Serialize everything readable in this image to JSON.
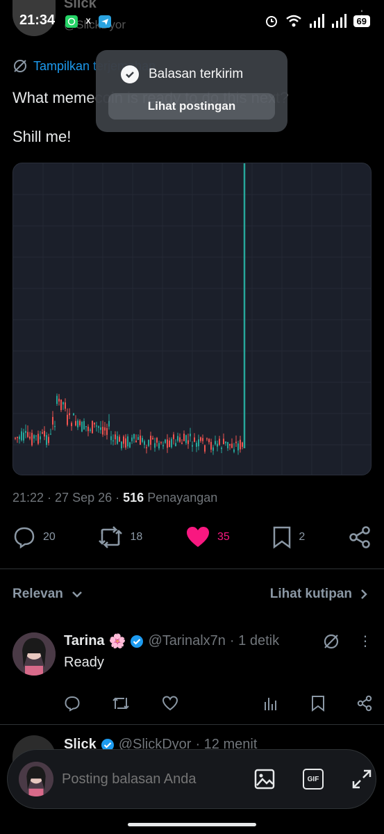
{
  "status_bar": {
    "time": "21:34",
    "apps": [
      {
        "icon": "whatsapp-icon",
        "color": "#25d366"
      },
      {
        "icon": "x-icon",
        "color": "#000000"
      },
      {
        "icon": "telegram-icon",
        "color": "#2aa3e0"
      }
    ],
    "battery": "69"
  },
  "post": {
    "author_name": "Slick",
    "author_handle": "@SlickDyor",
    "translate_label": "Tampilkan terjemahan",
    "text_line1": "What memecoin is ready to do this next?",
    "text_line2": "Shill me!",
    "time": "21:22",
    "date": "27 Sep 26",
    "views": "516",
    "views_label": "Penayangan",
    "stats": {
      "replies": "20",
      "reposts": "18",
      "likes": "35",
      "bookmarks": "2"
    }
  },
  "colors": {
    "accent": "#1d9bf0",
    "like": "#f91880",
    "chart_bg": "#1b1f2a",
    "candle_up": "#26a69a",
    "candle_down": "#ef5350"
  },
  "sort": {
    "relevan_label": "Relevan",
    "quotes_label": "Lihat kutipan"
  },
  "replies": [
    {
      "name": "Tarina",
      "emoji": "🌸",
      "handle": "@Tarinalx7n",
      "time": "· 1 detik",
      "text": "Ready"
    },
    {
      "name": "Slick",
      "handle": "@SlickDyor",
      "time": "· 12 menit"
    }
  ],
  "composer": {
    "placeholder": "Posting balasan Anda",
    "gif_label": "GIF"
  },
  "toast": {
    "message": "Balasan terkirim",
    "button": "Lihat postingan"
  }
}
